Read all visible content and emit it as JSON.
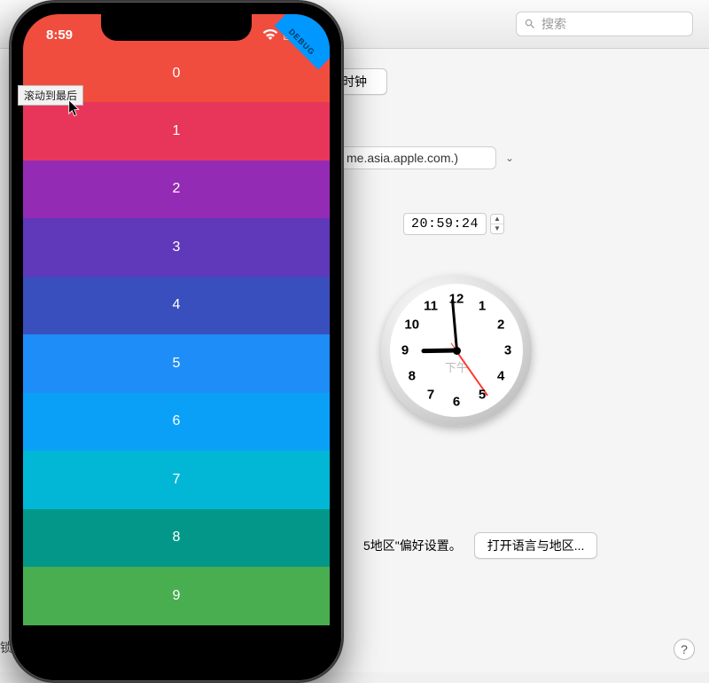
{
  "prefs": {
    "search_placeholder": "搜索",
    "tab_clock": "时钟",
    "server_value": "me.asia.apple.com.)",
    "time_value": "20:59:24",
    "clock_numbers": [
      "12",
      "1",
      "2",
      "3",
      "4",
      "5",
      "6",
      "7",
      "8",
      "9",
      "10",
      "11"
    ],
    "clock_meridiem": "下午",
    "hour_angle": 269,
    "minute_angle": 355,
    "second_angle": 145,
    "footer_text": "5地区\"偏好设置。",
    "open_lang_button": "打开语言与地区...",
    "lock_hint": "锁按",
    "help": "?"
  },
  "phone": {
    "time": "8:59",
    "debug_label": "DEBUG",
    "rows": [
      {
        "label": "0",
        "color": "#F04D3E"
      },
      {
        "label": "1",
        "color": "#E8365B"
      },
      {
        "label": "2",
        "color": "#942BB4"
      },
      {
        "label": "3",
        "color": "#6038BA"
      },
      {
        "label": "4",
        "color": "#3A4FBE"
      },
      {
        "label": "5",
        "color": "#1F8DF7"
      },
      {
        "label": "6",
        "color": "#0AA0F8"
      },
      {
        "label": "7",
        "color": "#01B7D5"
      },
      {
        "label": "8",
        "color": "#039789"
      },
      {
        "label": "9",
        "color": "#49AE4F"
      }
    ]
  },
  "tooltip": "滚动到最后"
}
